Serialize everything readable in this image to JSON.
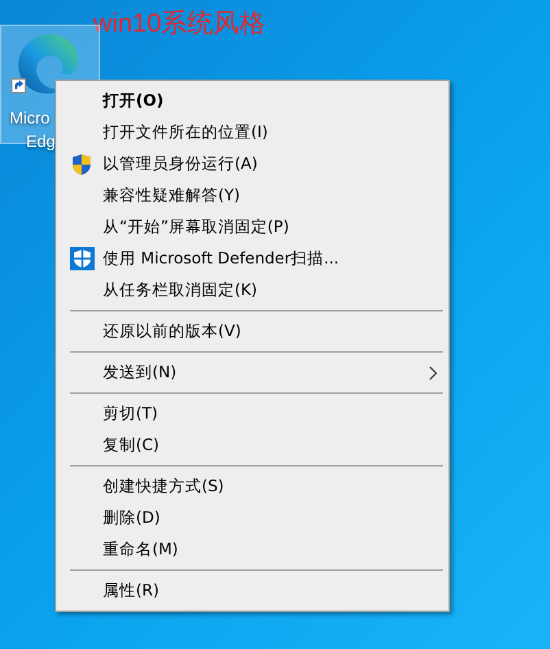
{
  "annotation": "win10系统风格",
  "desktop_icon": {
    "selected": true,
    "label_lines": [
      "Micro",
      "Edg"
    ]
  },
  "context_menu": {
    "items": [
      {
        "kind": "item",
        "label": "打开(O)",
        "default": true
      },
      {
        "kind": "item",
        "label": "打开文件所在的位置(I)",
        "default": false
      },
      {
        "kind": "shield_item",
        "label": "以管理员身份运行(A)",
        "default": false
      },
      {
        "kind": "item",
        "label": "兼容性疑难解答(Y)",
        "default": false
      },
      {
        "kind": "item",
        "label": "从“开始”屏幕取消固定(P)",
        "default": false
      },
      {
        "kind": "defender_item",
        "label": "使用 Microsoft Defender扫描...",
        "default": false
      },
      {
        "kind": "item",
        "label": "从任务栏取消固定(K)",
        "default": false
      },
      {
        "kind": "separator"
      },
      {
        "kind": "item",
        "label": "还原以前的版本(V)",
        "default": false
      },
      {
        "kind": "separator"
      },
      {
        "kind": "submenu_item",
        "label": "发送到(N)",
        "default": false
      },
      {
        "kind": "separator"
      },
      {
        "kind": "item",
        "label": "剪切(T)",
        "default": false
      },
      {
        "kind": "item",
        "label": "复制(C)",
        "default": false
      },
      {
        "kind": "separator"
      },
      {
        "kind": "item",
        "label": "创建快捷方式(S)",
        "default": false
      },
      {
        "kind": "item",
        "label": "删除(D)",
        "default": false
      },
      {
        "kind": "item",
        "label": "重命名(M)",
        "default": false
      },
      {
        "kind": "separator"
      },
      {
        "kind": "item",
        "label": "属性(R)",
        "default": false
      }
    ]
  }
}
